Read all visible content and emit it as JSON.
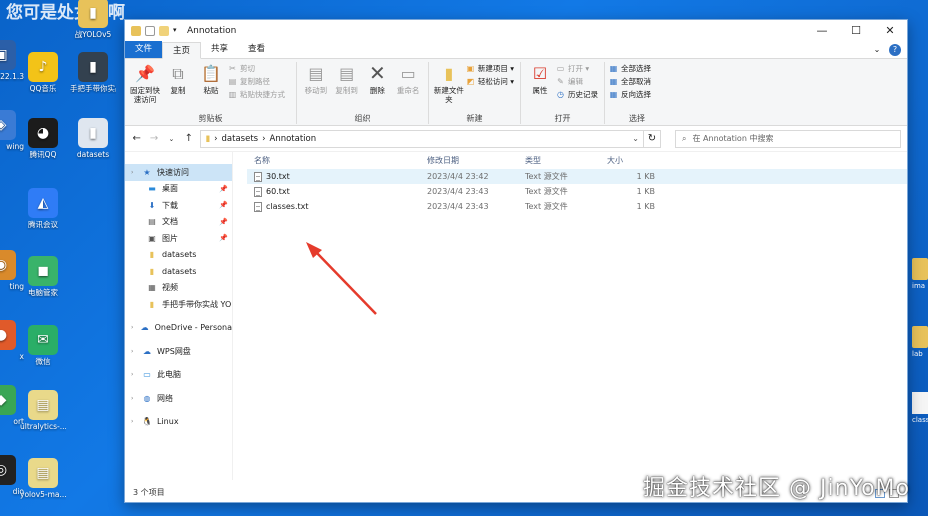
{
  "desktop": {
    "banner": "您可是处女座啊",
    "left_icons": [
      {
        "label": "2022.1.3",
        "icon": "app-icon",
        "color": "#2b5fa8",
        "glyph": "▣"
      },
      {
        "label": "wing",
        "icon": "app-icon",
        "color": "#3a7bd5",
        "glyph": "◈"
      },
      {
        "label": "ting",
        "icon": "app-icon",
        "color": "#d98a2b",
        "glyph": "◉"
      },
      {
        "label": "x",
        "icon": "app-icon",
        "color": "#e05a2a",
        "glyph": "●"
      },
      {
        "label": "ort",
        "icon": "app-icon",
        "color": "#3aa655",
        "glyph": "◆"
      },
      {
        "label": "dio",
        "icon": "app-icon",
        "color": "#222",
        "glyph": "◎"
      }
    ],
    "icons": [
      {
        "label": "战YOLOv5",
        "icon": "folder-icon",
        "color": "#e8c25a",
        "glyph": "▮"
      },
      {
        "label": "QQ音乐",
        "icon": "qqmusic-icon",
        "color": "#f3c318",
        "glyph": "♪"
      },
      {
        "label": "手把手带你实战YOLOv8",
        "icon": "folder-icon",
        "color": "#33414f",
        "glyph": "▮"
      },
      {
        "label": "腾讯QQ",
        "icon": "qq-icon",
        "color": "#1c1c1c",
        "glyph": "◕"
      },
      {
        "label": "datasets",
        "icon": "folder-icon",
        "color": "#dfe6ef",
        "glyph": "▮"
      },
      {
        "label": "腾讯会议",
        "icon": "meeting-icon",
        "color": "#2f7cf6",
        "glyph": "◭"
      },
      {
        "label": "电脑管家",
        "icon": "pcmanager-icon",
        "color": "#39b36a",
        "glyph": "◼"
      },
      {
        "label": "微信",
        "icon": "wechat-icon",
        "color": "#2aae67",
        "glyph": "✉"
      },
      {
        "label": "ultralytics-...",
        "icon": "zip-icon",
        "color": "#e9d98a",
        "glyph": "▤"
      },
      {
        "label": "yolov5-ma...",
        "icon": "zip-icon",
        "color": "#e9d98a",
        "glyph": "▤"
      }
    ],
    "right_icons": [
      {
        "label": "ima",
        "type": "folder"
      },
      {
        "label": "lab",
        "type": "folder"
      },
      {
        "label": "class",
        "type": "doc"
      }
    ]
  },
  "window": {
    "title": "Annotation",
    "controls": {
      "minimize": "—",
      "maximize": "☐",
      "close": "✕"
    },
    "tabs": [
      {
        "label": "文件",
        "kind": "file"
      },
      {
        "label": "主页",
        "kind": "active"
      },
      {
        "label": "共享",
        "kind": "normal"
      },
      {
        "label": "查看",
        "kind": "normal"
      }
    ],
    "ribbon": {
      "clipboard": {
        "name": "剪贴板",
        "pin": "固定到快速访问",
        "copy": "复制",
        "paste": "粘贴",
        "cut": "剪切",
        "copy_path": "复制路径",
        "paste_shortcut": "粘贴快捷方式"
      },
      "organize": {
        "name": "组织",
        "move_to": "移动到",
        "copy_to": "复制到",
        "delete": "删除",
        "rename": "重命名"
      },
      "new": {
        "name": "新建",
        "new_folder": "新建文件夹",
        "new_item": "新建项目 ▾",
        "easy_access": "轻松访问 ▾"
      },
      "open": {
        "name": "打开",
        "properties": "属性",
        "open": "打开 ▾",
        "edit": "编辑",
        "history": "历史记录"
      },
      "select": {
        "name": "选择",
        "select_all": "全部选择",
        "select_none": "全部取消",
        "invert": "反向选择"
      }
    },
    "address": {
      "path": [
        "datasets",
        "Annotation"
      ],
      "search_placeholder": "在 Annotation 中搜索"
    },
    "nav": [
      {
        "label": "快速访问",
        "level": "top",
        "icon": "star-icon",
        "glyph": "★",
        "color": "#2b6fc4",
        "selected": true
      },
      {
        "label": "桌面",
        "level": "sub",
        "icon": "desktop-icon",
        "glyph": "▬",
        "color": "#2b8ad9",
        "pinned": true
      },
      {
        "label": "下载",
        "level": "sub",
        "icon": "download-icon",
        "glyph": "⬇",
        "color": "#2b6fc4",
        "pinned": true
      },
      {
        "label": "文档",
        "level": "sub",
        "icon": "document-icon",
        "glyph": "▤",
        "color": "#555",
        "pinned": true
      },
      {
        "label": "图片",
        "level": "sub",
        "icon": "picture-icon",
        "glyph": "▣",
        "color": "#555",
        "pinned": true
      },
      {
        "label": "datasets",
        "level": "sub",
        "icon": "folder-icon",
        "glyph": "▮",
        "color": "#e8c25a"
      },
      {
        "label": "datasets",
        "level": "sub",
        "icon": "folder-icon",
        "glyph": "▮",
        "color": "#e8c25a"
      },
      {
        "label": "视频",
        "level": "sub",
        "icon": "video-icon",
        "glyph": "▦",
        "color": "#555"
      },
      {
        "label": "手把手带你实战 YO",
        "level": "sub",
        "icon": "folder-icon",
        "glyph": "▮",
        "color": "#e8c25a"
      },
      {
        "label": "OneDrive - Persona",
        "level": "top",
        "icon": "onedrive-icon",
        "glyph": "☁",
        "color": "#2b6fc4",
        "gap": true
      },
      {
        "label": "WPS网盘",
        "level": "top",
        "icon": "cloud-icon",
        "glyph": "☁",
        "color": "#2b6fc4",
        "gap": true
      },
      {
        "label": "此电脑",
        "level": "top",
        "icon": "computer-icon",
        "glyph": "▭",
        "color": "#2b8ad9",
        "gap": true
      },
      {
        "label": "网络",
        "level": "top",
        "icon": "network-icon",
        "glyph": "◍",
        "color": "#2b6fc4",
        "gap": true
      },
      {
        "label": "Linux",
        "level": "top",
        "icon": "linux-icon",
        "glyph": "🐧",
        "color": "#333",
        "gap": true
      }
    ],
    "columns": {
      "name": "名称",
      "date": "修改日期",
      "type": "类型",
      "size": "大小"
    },
    "files": [
      {
        "name": "30.txt",
        "date": "2023/4/4 23:42",
        "type": "Text 源文件",
        "size": "1 KB",
        "hover": true
      },
      {
        "name": "60.txt",
        "date": "2023/4/4 23:43",
        "type": "Text 源文件",
        "size": "1 KB"
      },
      {
        "name": "classes.txt",
        "date": "2023/4/4 23:43",
        "type": "Text 源文件",
        "size": "1 KB"
      }
    ],
    "status": "3 个项目"
  },
  "watermark": "掘金技术社区 @ JinYoMo",
  "colors": {
    "accent": "#1a6fd0",
    "arrow": "#e53b2c",
    "desktop": "#0a63c9"
  }
}
